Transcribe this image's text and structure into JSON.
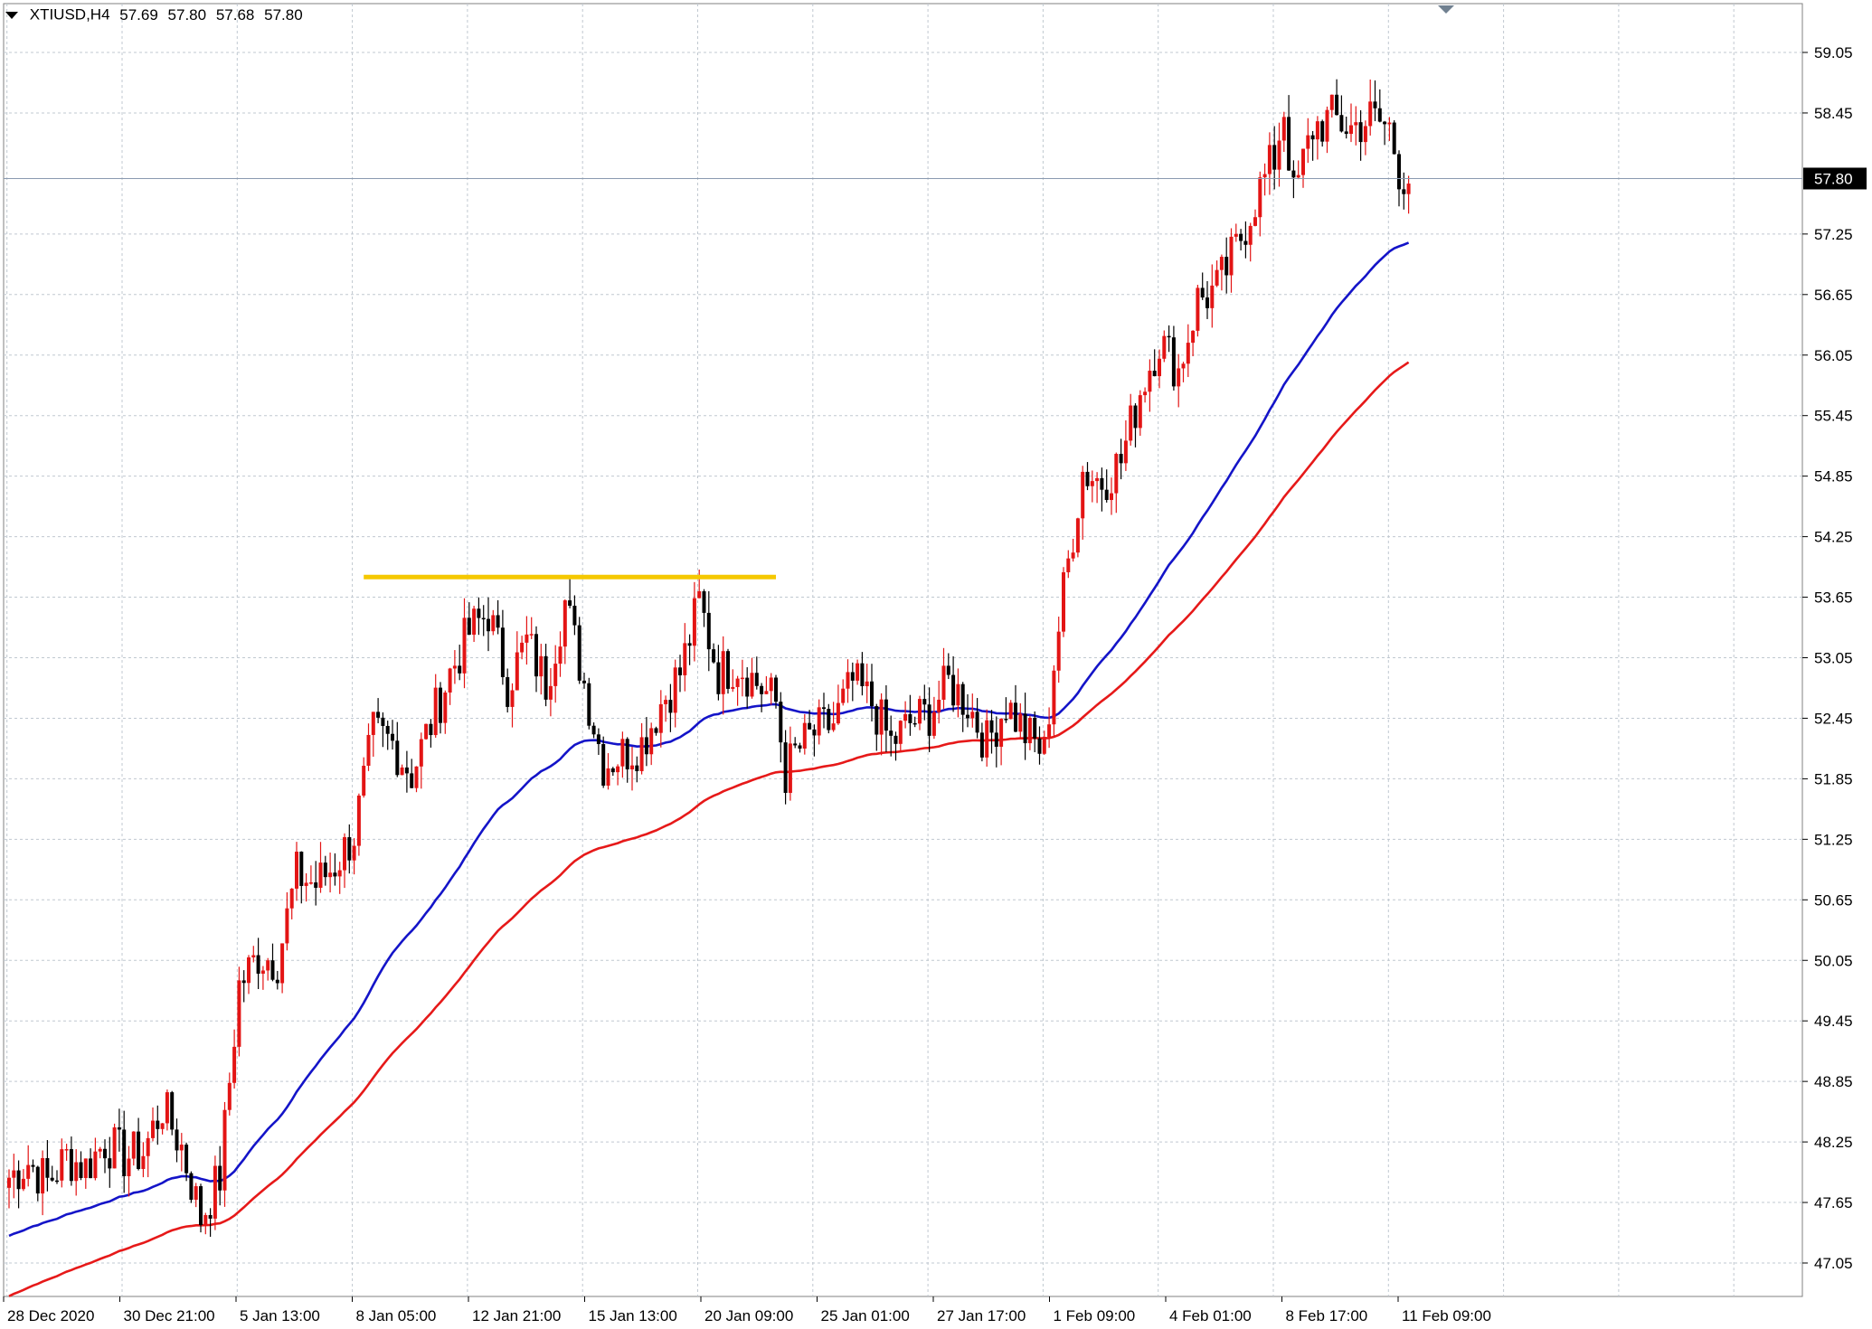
{
  "header": {
    "symbol": "XTIUSD,H4",
    "open": "57.69",
    "high": "57.80",
    "low": "57.68",
    "close": "57.80"
  },
  "colors": {
    "bull_candle": "#e31414",
    "bear_candle": "#000000",
    "ma_fast": "#1414c8",
    "ma_slow": "#e61919",
    "resistance_line": "#f5c800",
    "grid": "#c0c8d0",
    "price_marker_bg": "#000000",
    "price_marker_text": "#ffffff"
  },
  "chart_data": {
    "type": "candlestick",
    "symbol": "XTIUSD",
    "timeframe": "H4",
    "y_ticks": [
      "59.05",
      "58.45",
      "57.25",
      "56.65",
      "56.05",
      "55.45",
      "54.85",
      "54.25",
      "53.65",
      "53.05",
      "52.45",
      "51.85",
      "51.25",
      "50.65",
      "50.05",
      "49.45",
      "48.85",
      "48.25",
      "47.65",
      "47.05"
    ],
    "ylim": [
      46.75,
      59.3
    ],
    "x_labels": [
      "28 Dec 2020",
      "30 Dec 21:00",
      "5 Jan 13:00",
      "8 Jan 05:00",
      "12 Jan 21:00",
      "15 Jan 13:00",
      "20 Jan 09:00",
      "25 Jan 01:00",
      "27 Jan 17:00",
      "1 Feb 09:00",
      "4 Feb 01:00",
      "8 Feb 17:00",
      "11 Feb 09:00"
    ],
    "x_label_bars": [
      0,
      24,
      48,
      72,
      96,
      120,
      144,
      168,
      192,
      216,
      240,
      264,
      288
    ],
    "current_price": "57.80",
    "resistance_level": 53.85,
    "resistance_span_bars": [
      74,
      160
    ],
    "anchors": [
      [
        0,
        47.9
      ],
      [
        4,
        48.05
      ],
      [
        8,
        47.85
      ],
      [
        12,
        48.1
      ],
      [
        16,
        48.0
      ],
      [
        20,
        48.25
      ],
      [
        24,
        48.1
      ],
      [
        28,
        48.15
      ],
      [
        32,
        48.6
      ],
      [
        36,
        48.2
      ],
      [
        40,
        47.5
      ],
      [
        44,
        47.9
      ],
      [
        48,
        49.8
      ],
      [
        52,
        50.1
      ],
      [
        56,
        50.05
      ],
      [
        60,
        50.9
      ],
      [
        64,
        50.8
      ],
      [
        68,
        51.0
      ],
      [
        72,
        51.3
      ],
      [
        76,
        52.3
      ],
      [
        80,
        52.2
      ],
      [
        84,
        51.9
      ],
      [
        88,
        52.4
      ],
      [
        92,
        52.9
      ],
      [
        96,
        53.3
      ],
      [
        100,
        53.5
      ],
      [
        104,
        52.8
      ],
      [
        108,
        53.2
      ],
      [
        112,
        52.8
      ],
      [
        116,
        53.6
      ],
      [
        120,
        52.8
      ],
      [
        124,
        52.0
      ],
      [
        128,
        52.1
      ],
      [
        132,
        52.2
      ],
      [
        136,
        52.6
      ],
      [
        140,
        52.9
      ],
      [
        144,
        53.6
      ],
      [
        148,
        52.9
      ],
      [
        152,
        53.0
      ],
      [
        156,
        52.8
      ],
      [
        160,
        52.6
      ],
      [
        162,
        51.9
      ],
      [
        164,
        52.1
      ],
      [
        168,
        52.3
      ],
      [
        172,
        52.4
      ],
      [
        176,
        52.8
      ],
      [
        180,
        52.6
      ],
      [
        184,
        52.2
      ],
      [
        188,
        52.4
      ],
      [
        192,
        52.5
      ],
      [
        196,
        52.8
      ],
      [
        200,
        52.6
      ],
      [
        204,
        52.2
      ],
      [
        208,
        52.6
      ],
      [
        212,
        52.3
      ],
      [
        216,
        52.1
      ],
      [
        218,
        53.0
      ],
      [
        220,
        53.7
      ],
      [
        224,
        54.9
      ],
      [
        228,
        54.8
      ],
      [
        232,
        55.0
      ],
      [
        236,
        55.7
      ],
      [
        240,
        56.2
      ],
      [
        244,
        55.9
      ],
      [
        248,
        56.6
      ],
      [
        252,
        56.7
      ],
      [
        256,
        57.1
      ],
      [
        260,
        57.6
      ],
      [
        264,
        58.0
      ],
      [
        266,
        58.5
      ],
      [
        268,
        57.6
      ],
      [
        272,
        58.3
      ],
      [
        276,
        58.4
      ],
      [
        280,
        58.3
      ],
      [
        284,
        58.4
      ],
      [
        288,
        58.3
      ],
      [
        290,
        57.9
      ],
      [
        292,
        57.75
      ]
    ],
    "series": [
      {
        "name": "",
        "kind": "candles"
      },
      {
        "name": "",
        "kind": "moving-average",
        "start": 47.3,
        "end": 56.7
      },
      {
        "name": "",
        "kind": "moving-average",
        "start": 46.7,
        "end": 55.65
      }
    ],
    "grid": true
  }
}
